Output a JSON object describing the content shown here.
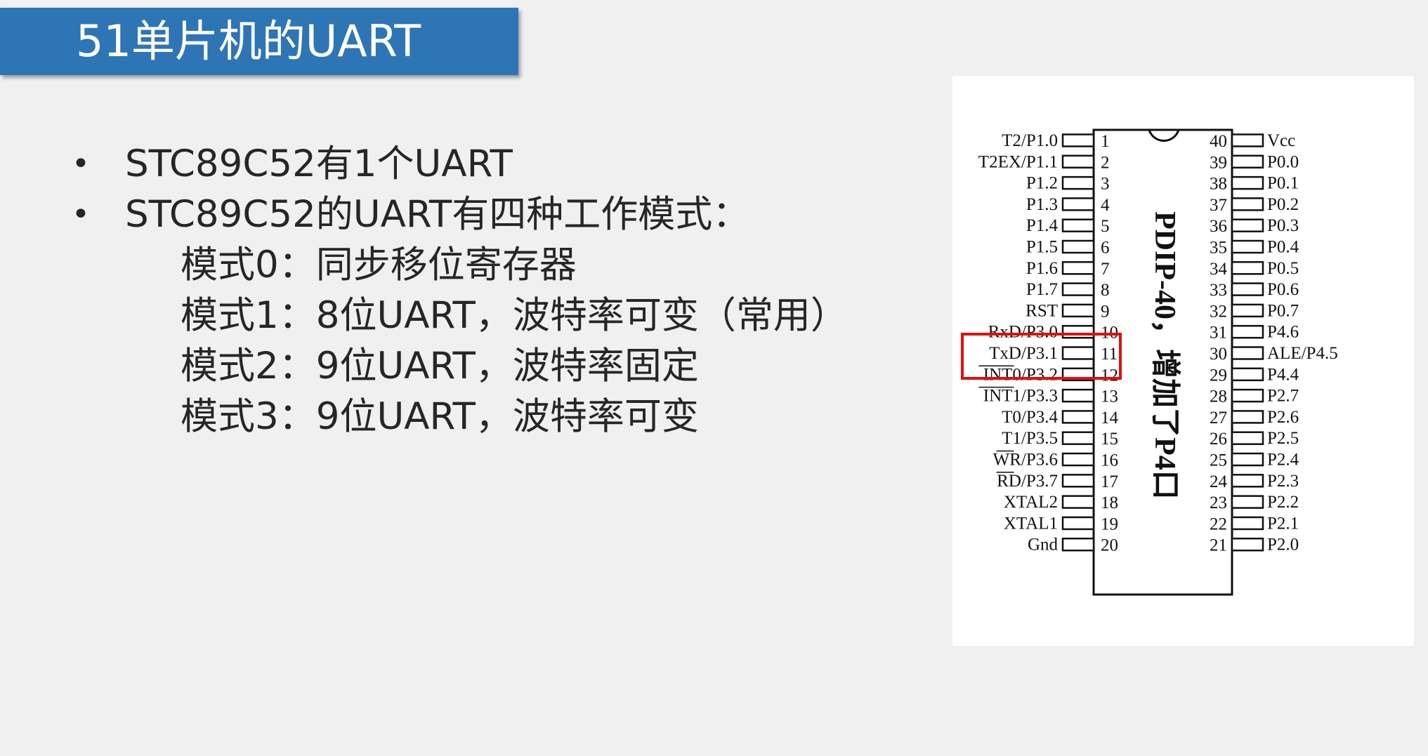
{
  "slide": {
    "title": "51单片机的UART"
  },
  "bullets": [
    "STC89C52有1个UART",
    "STC89C52的UART有四种工作模式："
  ],
  "modes": [
    "模式0：同步移位寄存器",
    "模式1：8位UART，波特率可变（常用）",
    "模式2：9位UART，波特率固定",
    "模式3：9位UART，波特率可变"
  ],
  "diagram": {
    "chip_label": "PDIP-40，增加了P4口",
    "left_pins": [
      {
        "label": "T2/P1.0",
        "num": "1"
      },
      {
        "label": "T2EX/P1.1",
        "num": "2"
      },
      {
        "label": "P1.2",
        "num": "3"
      },
      {
        "label": "P1.3",
        "num": "4"
      },
      {
        "label": "P1.4",
        "num": "5"
      },
      {
        "label": "P1.5",
        "num": "6"
      },
      {
        "label": "P1.6",
        "num": "7"
      },
      {
        "label": "P1.7",
        "num": "8"
      },
      {
        "label": "RST",
        "num": "9"
      },
      {
        "label": "RxD/P3.0",
        "num": "10"
      },
      {
        "label": "TxD/P3.1",
        "num": "11"
      },
      {
        "label": "INT0/P3.2",
        "num": "12"
      },
      {
        "label": "INT1/P3.3",
        "num": "13"
      },
      {
        "label": "T0/P3.4",
        "num": "14"
      },
      {
        "label": "T1/P3.5",
        "num": "15"
      },
      {
        "label": "WR/P3.6",
        "num": "16"
      },
      {
        "label": "RD/P3.7",
        "num": "17"
      },
      {
        "label": "XTAL2",
        "num": "18"
      },
      {
        "label": "XTAL1",
        "num": "19"
      },
      {
        "label": "Gnd",
        "num": "20"
      }
    ],
    "right_pins": [
      {
        "label": "Vcc",
        "num": "40"
      },
      {
        "label": "P0.0",
        "num": "39"
      },
      {
        "label": "P0.1",
        "num": "38"
      },
      {
        "label": "P0.2",
        "num": "37"
      },
      {
        "label": "P0.3",
        "num": "36"
      },
      {
        "label": "P0.4",
        "num": "35"
      },
      {
        "label": "P0.5",
        "num": "34"
      },
      {
        "label": "P0.6",
        "num": "33"
      },
      {
        "label": "P0.7",
        "num": "32"
      },
      {
        "label": "P4.6",
        "num": "31"
      },
      {
        "label": "ALE/P4.5",
        "num": "30"
      },
      {
        "label": "P4.4",
        "num": "29"
      },
      {
        "label": "P2.7",
        "num": "28"
      },
      {
        "label": "P2.6",
        "num": "27"
      },
      {
        "label": "P2.5",
        "num": "26"
      },
      {
        "label": "P2.4",
        "num": "25"
      },
      {
        "label": "P2.3",
        "num": "24"
      },
      {
        "label": "P2.2",
        "num": "23"
      },
      {
        "label": "P2.1",
        "num": "22"
      },
      {
        "label": "P2.0",
        "num": "21"
      }
    ],
    "highlight_color": "#e01010"
  },
  "colors": {
    "title_bar": "#2e75b6",
    "title_text": "#ffffff",
    "body_text": "#262626",
    "background": "#f0f0f0"
  }
}
